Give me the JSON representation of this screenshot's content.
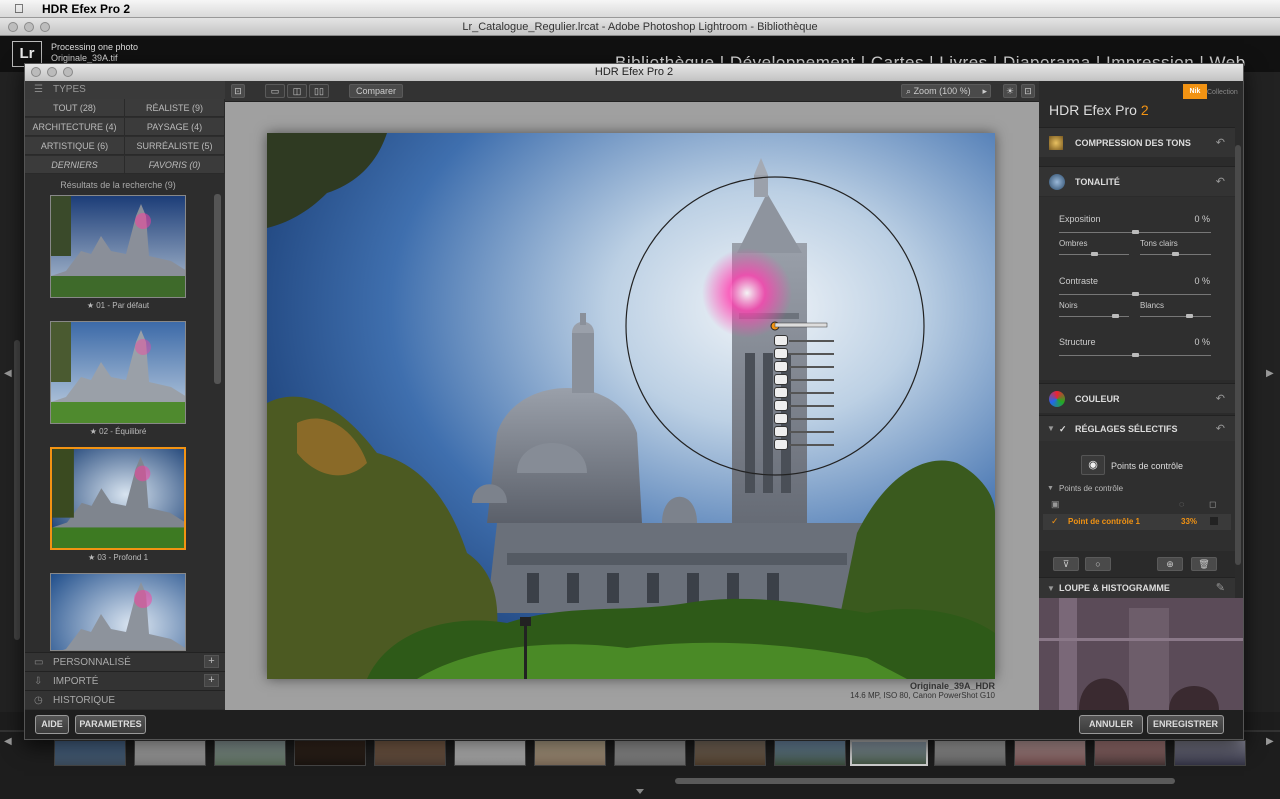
{
  "mac": {
    "app_name": "HDR Efex Pro 2"
  },
  "lightroom": {
    "window_title": "Lr_Catalogue_Regulier.lrcat - Adobe Photoshop Lightroom - Bibliothèque",
    "logo": "Lr",
    "processing": "Processing one photo",
    "file": "Originale_39A.tif",
    "modules": "Bibliothèque | Développement | Cartes | Livres | Diaporama | Impression | Web"
  },
  "hdr": {
    "window_title": "HDR Efex Pro 2",
    "left": {
      "types_header": "TYPES",
      "types": [
        {
          "label": "TOUT (28)"
        },
        {
          "label": "RÉALISTE (9)"
        },
        {
          "label": "ARCHITECTURE (4)"
        },
        {
          "label": "PAYSAGE (4)"
        },
        {
          "label": "ARTISTIQUE (6)"
        },
        {
          "label": "SURRÉALISTE (5)"
        },
        {
          "label": "DERNIERS"
        },
        {
          "label": "FAVORIS (0)"
        }
      ],
      "results_header": "Résultats de la recherche (9)",
      "presets": [
        {
          "label": "★ 01 - Par défaut"
        },
        {
          "label": "★ 02 - Équilibré"
        },
        {
          "label": "★ 03 - Profond 1"
        }
      ],
      "sections": [
        {
          "label": "PERSONNALISÉ",
          "action": "+"
        },
        {
          "label": "IMPORTÉ",
          "action": "+"
        },
        {
          "label": "HISTORIQUE",
          "action": ""
        }
      ]
    },
    "toolbar": {
      "compare": "Comparer",
      "zoom": "Zoom (100 %)"
    },
    "canvas": {
      "photo_name": "Originale_39A_HDR",
      "photo_meta": "14.6 MP, ISO 80, Canon PowerShot G10"
    },
    "control_point_tags": [
      "Ex",
      "Co",
      "St",
      "Sa",
      "Bl",
      "Wh",
      "Te",
      "Ti",
      "IM"
    ],
    "right": {
      "brand": "Nik",
      "brand_sub": "Collection",
      "title": "HDR Efex Pro",
      "title_num": "2",
      "sections": {
        "compression": "COMPRESSION DES TONS",
        "tonalite": "TONALITÉ",
        "couleur": "COULEUR",
        "selectifs": "RÉGLAGES SÉLECTIFS",
        "loupe": "LOUPE & HISTOGRAMME"
      },
      "tone": {
        "exposition": "Exposition",
        "exposition_val": "0 %",
        "exposition_level": 0.5,
        "ombres": "Ombres",
        "ombres_level": 0.5,
        "tons_clairs": "Tons clairs",
        "tons_clairs_level": 0.5,
        "contraste": "Contraste",
        "contraste_val": "0 %",
        "contraste_level": 0.5,
        "noirs": "Noirs",
        "noirs_level": 0.8,
        "blancs": "Blancs",
        "blancs_level": 0.7,
        "structure": "Structure",
        "structure_val": "0 %",
        "structure_level": 0.5
      },
      "points_button": "Points de contrôle",
      "points_header": "Points de contrôle",
      "point1": {
        "name": "Point de contrôle 1",
        "opacity": "33%"
      }
    },
    "bottom": {
      "help": "AIDE",
      "params": "PARAMETRES",
      "cancel": "ANNULER",
      "save": "ENREGISTRER"
    }
  },
  "colors": {
    "accent": "#f29313",
    "panel": "#2d2d2d",
    "canvas": "#a0a0a0"
  }
}
